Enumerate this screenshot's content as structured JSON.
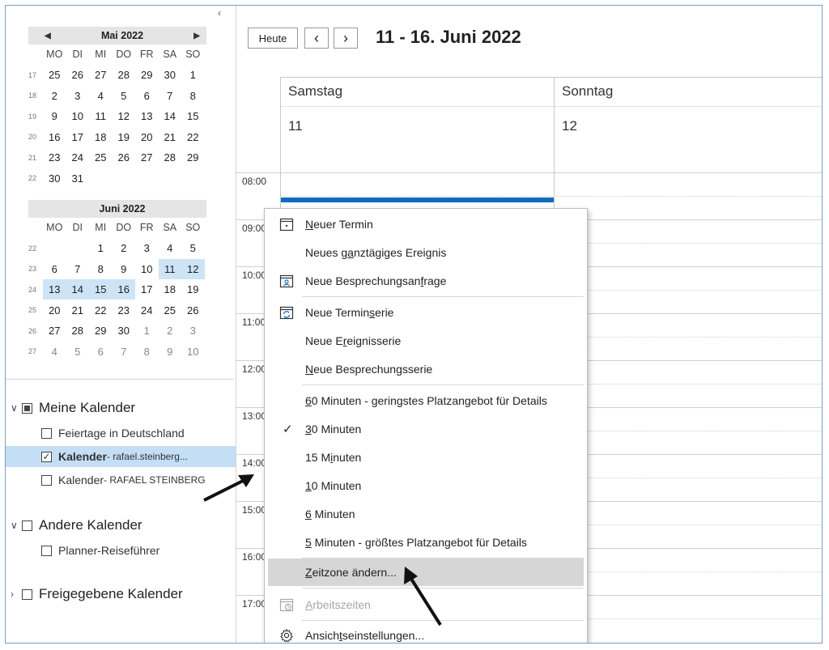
{
  "collapse_icon": "‹",
  "may": {
    "title": "Mai 2022",
    "dows": [
      "MO",
      "DI",
      "MI",
      "DO",
      "FR",
      "SA",
      "SO"
    ],
    "rows": [
      {
        "wk": "17",
        "days": [
          {
            "d": "25"
          },
          {
            "d": "26"
          },
          {
            "d": "27"
          },
          {
            "d": "28"
          },
          {
            "d": "29"
          },
          {
            "d": "30"
          },
          {
            "d": "1"
          }
        ]
      },
      {
        "wk": "18",
        "days": [
          {
            "d": "2"
          },
          {
            "d": "3"
          },
          {
            "d": "4"
          },
          {
            "d": "5"
          },
          {
            "d": "6"
          },
          {
            "d": "7"
          },
          {
            "d": "8"
          }
        ]
      },
      {
        "wk": "19",
        "days": [
          {
            "d": "9"
          },
          {
            "d": "10"
          },
          {
            "d": "11"
          },
          {
            "d": "12"
          },
          {
            "d": "13"
          },
          {
            "d": "14"
          },
          {
            "d": "15"
          }
        ]
      },
      {
        "wk": "20",
        "days": [
          {
            "d": "16"
          },
          {
            "d": "17"
          },
          {
            "d": "18"
          },
          {
            "d": "19"
          },
          {
            "d": "20"
          },
          {
            "d": "21"
          },
          {
            "d": "22"
          }
        ]
      },
      {
        "wk": "21",
        "days": [
          {
            "d": "23"
          },
          {
            "d": "24"
          },
          {
            "d": "25"
          },
          {
            "d": "26"
          },
          {
            "d": "27"
          },
          {
            "d": "28"
          },
          {
            "d": "29"
          }
        ]
      },
      {
        "wk": "22",
        "days": [
          {
            "d": "30"
          },
          {
            "d": "31"
          },
          {
            "d": ""
          },
          {
            "d": ""
          },
          {
            "d": ""
          },
          {
            "d": ""
          },
          {
            "d": ""
          }
        ]
      }
    ]
  },
  "june": {
    "title": "Juni 2022",
    "dows": [
      "MO",
      "DI",
      "MI",
      "DO",
      "FR",
      "SA",
      "SO"
    ],
    "rows": [
      {
        "wk": "22",
        "days": [
          {
            "d": ""
          },
          {
            "d": ""
          },
          {
            "d": "1"
          },
          {
            "d": "2"
          },
          {
            "d": "3"
          },
          {
            "d": "4"
          },
          {
            "d": "5"
          }
        ]
      },
      {
        "wk": "23",
        "days": [
          {
            "d": "6"
          },
          {
            "d": "7"
          },
          {
            "d": "8"
          },
          {
            "d": "9"
          },
          {
            "d": "10"
          },
          {
            "d": "11",
            "hl": true
          },
          {
            "d": "12",
            "hl": true
          }
        ]
      },
      {
        "wk": "24",
        "days": [
          {
            "d": "13",
            "hl": true
          },
          {
            "d": "14",
            "hl": true
          },
          {
            "d": "15",
            "hl": true
          },
          {
            "d": "16",
            "hl": true
          },
          {
            "d": "17"
          },
          {
            "d": "18"
          },
          {
            "d": "19"
          }
        ]
      },
      {
        "wk": "25",
        "days": [
          {
            "d": "20"
          },
          {
            "d": "21"
          },
          {
            "d": "22"
          },
          {
            "d": "23"
          },
          {
            "d": "24"
          },
          {
            "d": "25"
          },
          {
            "d": "26"
          }
        ]
      },
      {
        "wk": "26",
        "days": [
          {
            "d": "27"
          },
          {
            "d": "28"
          },
          {
            "d": "29"
          },
          {
            "d": "30"
          },
          {
            "d": "1",
            "o": true
          },
          {
            "d": "2",
            "o": true
          },
          {
            "d": "3",
            "o": true
          }
        ]
      },
      {
        "wk": "27",
        "days": [
          {
            "d": "4",
            "o": true
          },
          {
            "d": "5",
            "o": true
          },
          {
            "d": "6",
            "o": true
          },
          {
            "d": "7",
            "o": true
          },
          {
            "d": "8",
            "o": true
          },
          {
            "d": "9",
            "o": true
          },
          {
            "d": "10",
            "o": true
          }
        ]
      }
    ]
  },
  "groups": {
    "meine": {
      "label": "Meine Kalender",
      "items": {
        "feiertage": "Feiertage in Deutschland",
        "kal1_bold": "Kalender",
        "kal1_rest": " - rafael.steinberg...",
        "kal2_a": "Kalender",
        "kal2_b": " - RAFAEL STEINBERG"
      }
    },
    "andere": {
      "label": "Andere Kalender",
      "items": {
        "planner": "Planner-Reiseführer"
      }
    },
    "freigegebene": {
      "label": "Freigegebene Kalender"
    }
  },
  "toolbar": {
    "today": "Heute",
    "prev": "‹",
    "next": "›",
    "range": "11 - 16. Juni 2022"
  },
  "days": [
    {
      "name": "Samstag",
      "num": "11"
    },
    {
      "name": "Sonntag",
      "num": "12"
    }
  ],
  "times": [
    "08:00",
    "09:00",
    "10:00",
    "11:00",
    "12:00",
    "13:00",
    "14:00",
    "15:00",
    "16:00",
    "17:00"
  ],
  "menu": {
    "neuer_termin": {
      "pre": "",
      "u": "N",
      "post": "euer Termin"
    },
    "ganztag": {
      "pre": "Neues g",
      "u": "a",
      "post": "nztägiges Ereignis"
    },
    "besprechung": {
      "pre": "Neue Besprechungsan",
      "u": "f",
      "post": "rage"
    },
    "terminserie": {
      "pre": "Neue Termin",
      "u": "s",
      "post": "erie"
    },
    "ereignisserie": {
      "pre": "Neue E",
      "u": "r",
      "post": "eignisserie"
    },
    "besprechungsserie": {
      "pre": "",
      "u": "N",
      "post": "eue Besprechungsserie"
    },
    "min60": {
      "pre": "",
      "u": "6",
      "post": "0 Minuten - geringstes Platzangebot für Details"
    },
    "min30": {
      "pre": "",
      "u": "3",
      "post": "0 Minuten"
    },
    "min15": {
      "pre": "15 M",
      "u": "i",
      "post": "nuten"
    },
    "min10": {
      "pre": "",
      "u": "1",
      "post": "0 Minuten"
    },
    "min6": {
      "pre": "",
      "u": "6",
      "post": " Minuten"
    },
    "min5": {
      "pre": "",
      "u": "5",
      "post": " Minuten - größtes Platzangebot für Details"
    },
    "zeitzone": {
      "pre": "",
      "u": "Z",
      "post": "eitzone ändern..."
    },
    "arbeitszeiten": {
      "pre": "",
      "u": "A",
      "post": "rbeitszeiten"
    },
    "ansicht": {
      "pre": "Ansich",
      "u": "t",
      "post": "seinstellungen..."
    },
    "checked_glyph": "✓"
  },
  "colors": {
    "accent": "#0f6cbd",
    "selection": "#cde4f7",
    "menu_highlight": "#d6d6d6"
  }
}
